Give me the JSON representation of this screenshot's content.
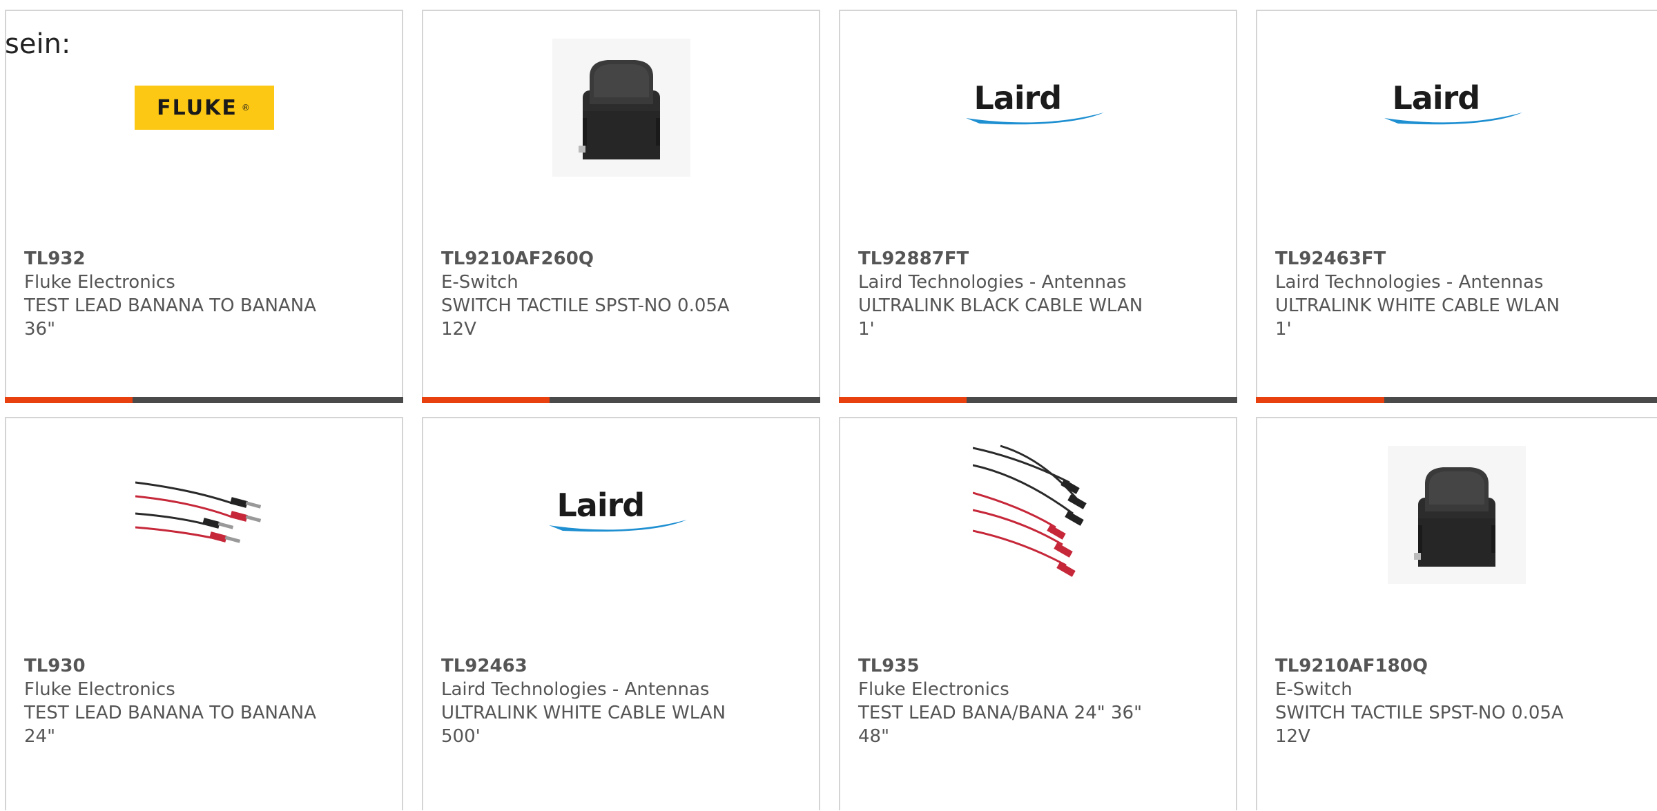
{
  "intro_text": "sein:",
  "colors": {
    "accent": "#e8400f",
    "bar": "#4a4a4a",
    "border": "#d4d4d4",
    "text": "#555555",
    "fluke_yellow": "#fcc814",
    "laird_blue": "#1e8fd1"
  },
  "products": [
    {
      "part_number": "TL932",
      "manufacturer": "Fluke Electronics",
      "description_line1": "TEST LEAD BANANA TO BANANA",
      "description_line2": "36\"",
      "image": "fluke-logo",
      "logo_text": "FLUKE",
      "logo_mark": "®"
    },
    {
      "part_number": "TL9210AF260Q",
      "manufacturer": "E-Switch",
      "description_line1": "SWITCH TACTILE SPST-NO 0.05A",
      "description_line2": "12V",
      "image": "tactile-switch"
    },
    {
      "part_number": "TL92887FT",
      "manufacturer": "Laird Technologies - Antennas",
      "description_line1": "ULTRALINK BLACK CABLE WLAN",
      "description_line2": "1'",
      "image": "laird-logo",
      "logo_text": "Laird"
    },
    {
      "part_number": "TL92463FT",
      "manufacturer": "Laird Technologies - Antennas",
      "description_line1": "ULTRALINK WHITE CABLE WLAN",
      "description_line2": "1'",
      "image": "laird-logo",
      "logo_text": "Laird"
    },
    {
      "part_number": "TL930",
      "manufacturer": "Fluke Electronics",
      "description_line1": "TEST LEAD BANANA TO BANANA",
      "description_line2": "24\"",
      "image": "test-leads-pair"
    },
    {
      "part_number": "TL92463",
      "manufacturer": "Laird Technologies - Antennas",
      "description_line1": "ULTRALINK WHITE CABLE WLAN",
      "description_line2": "500'",
      "image": "laird-logo",
      "logo_text": "Laird"
    },
    {
      "part_number": "TL935",
      "manufacturer": "Fluke Electronics",
      "description_line1": "TEST LEAD BANA/BANA 24\" 36\"",
      "description_line2": "48\"",
      "image": "test-leads-set"
    },
    {
      "part_number": "TL9210AF180Q",
      "manufacturer": "E-Switch",
      "description_line1": "SWITCH TACTILE SPST-NO 0.05A",
      "description_line2": "12V",
      "image": "tactile-switch"
    }
  ]
}
